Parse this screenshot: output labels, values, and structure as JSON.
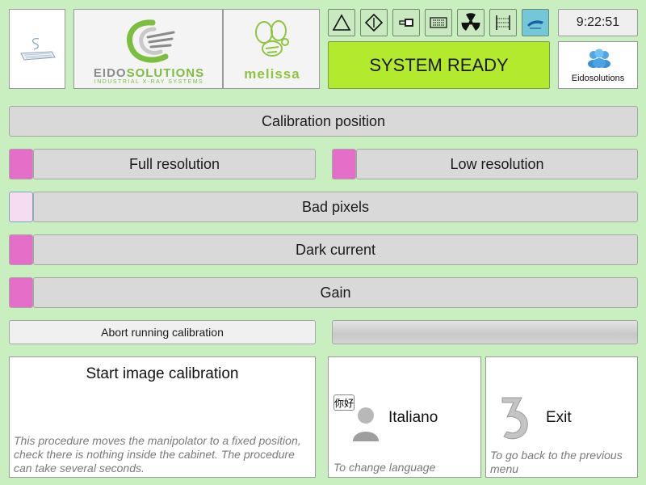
{
  "header": {
    "keyboard_icon": "keyboard-icon",
    "logo_eido": {
      "main_left": "EIDO",
      "main_right": "SOLUTIONS",
      "sub": "INDUSTRIAL X-RAY SYSTEMS"
    },
    "logo_melissa": {
      "text": "melissa"
    },
    "toolbar": [
      {
        "icon": "triangle-warning-icon",
        "active": false
      },
      {
        "icon": "diamond-icon",
        "active": false
      },
      {
        "icon": "xray-tube-icon",
        "active": false
      },
      {
        "icon": "detector-panel-icon",
        "active": false
      },
      {
        "icon": "radiation-icon",
        "active": false
      },
      {
        "icon": "bracket-frame-icon",
        "active": false
      },
      {
        "icon": "manipulator-icon",
        "active": true
      }
    ],
    "time": "9:22:51",
    "status": "SYSTEM READY",
    "status_color": "#b3ea2e",
    "profile_label": "Eidosolutions",
    "profile_icon": "users-icon"
  },
  "main": {
    "calibration_position_label": "Calibration position",
    "full_resolution_label": "Full resolution",
    "low_resolution_label": "Low resolution",
    "bad_pixels_label": "Bad pixels",
    "dark_current_label": "Dark current",
    "gain_label": "Gain",
    "abort_label": "Abort running calibration",
    "progress": 0
  },
  "footer": {
    "start": {
      "title": "Start image calibration",
      "description": "This procedure moves the manipolator to a fixed position, check there is nothing inside the cabinet. The procedure can take several seconds."
    },
    "language": {
      "label": "Italiano",
      "description": "To change language",
      "bubble_text": "你好"
    },
    "exit": {
      "label": "Exit",
      "description": "To go back to the previous menu"
    }
  },
  "colors": {
    "background": "#c9efc1",
    "checkbox_on": "#e56fc8",
    "checkbox_off": "#f6dcf1",
    "active_tool": "#74c7d6"
  }
}
